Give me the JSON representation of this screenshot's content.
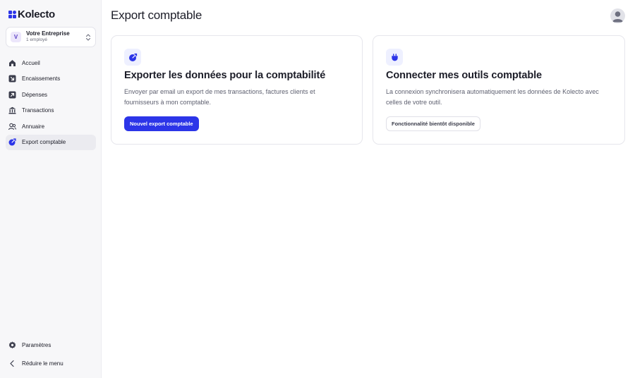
{
  "brand": {
    "name": "Kolecto",
    "accent": "#2c35e8"
  },
  "company": {
    "initial": "V",
    "name": "Votre Entreprise",
    "subtitle": "1 employé"
  },
  "nav": {
    "items": [
      {
        "label": "Accueil",
        "icon": "home-icon",
        "active": false
      },
      {
        "label": "Encaissements",
        "icon": "arrow-down-right-icon",
        "active": false
      },
      {
        "label": "Dépenses",
        "icon": "arrow-up-right-icon",
        "active": false
      },
      {
        "label": "Transactions",
        "icon": "bank-icon",
        "active": false
      },
      {
        "label": "Annuaire",
        "icon": "users-icon",
        "active": false
      },
      {
        "label": "Export comptable",
        "icon": "export-icon",
        "active": true
      }
    ],
    "bottom": [
      {
        "label": "Paramètres",
        "icon": "gear-icon"
      },
      {
        "label": "Réduire le menu",
        "icon": "chevron-left-icon"
      }
    ]
  },
  "page": {
    "title": "Export comptable"
  },
  "cards": [
    {
      "icon": "export-icon",
      "title": "Exporter les données pour la comptabilité",
      "description": "Envoyer par email un export de mes transactions, factures clients et fournisseurs à mon comptable.",
      "button": "Nouvel export comptable"
    },
    {
      "icon": "plug-icon",
      "title": "Connecter mes outils comptable",
      "description": "La connexion synchronisera automatiquement les données de Kolecto avec celles de votre outil.",
      "button": "Fonctionnalité bientôt disponible"
    }
  ]
}
